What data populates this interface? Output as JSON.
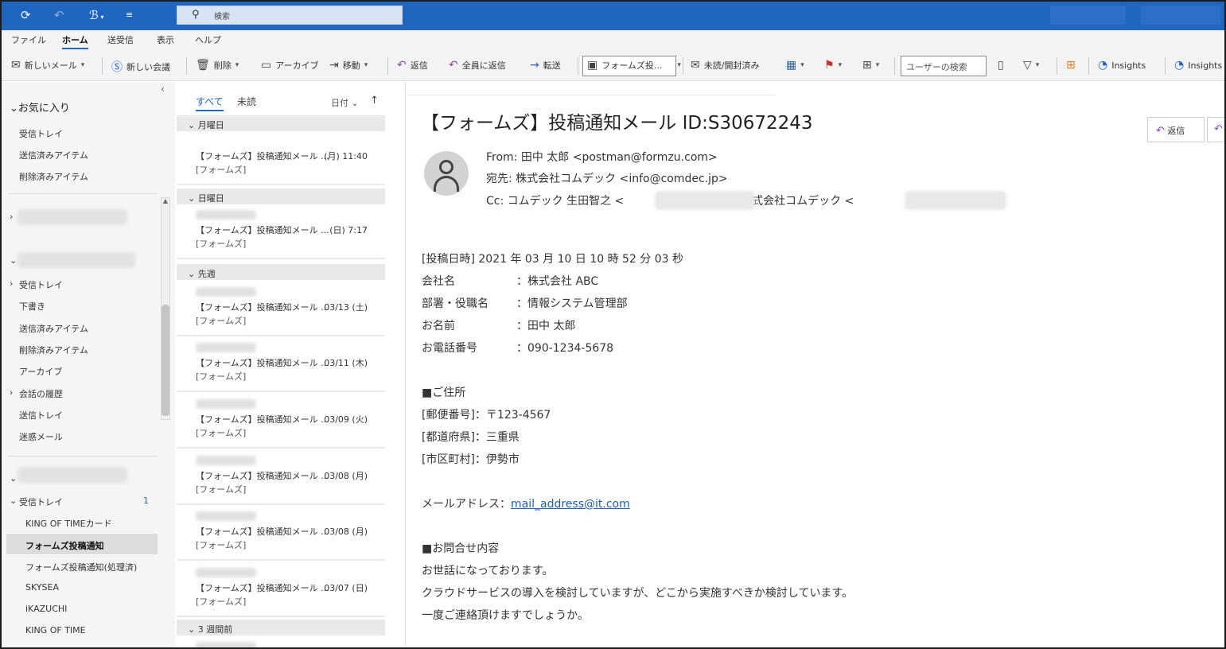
{
  "titlebar": {
    "search_icon": "search-icon",
    "search_placeholder": "検索"
  },
  "menu": [
    "ファイル",
    "ホーム",
    "送受信",
    "表示",
    "ヘルプ"
  ],
  "ribbon": {
    "new_mail": "新しいメール",
    "new_meeting": "新しい会議",
    "delete": "削除",
    "archive": "アーカイブ",
    "move": "移動",
    "reply": "返信",
    "reply_all": "全員に返信",
    "forward": "転送",
    "quick_step": "フォームズ投...",
    "unread_read": "未読/開封済み",
    "user_search": "ユーザーの検索",
    "insights1": "Insights",
    "insights2": "Insights"
  },
  "folders": {
    "favorites_title": "お気に入り",
    "favorites": [
      "受信トレイ",
      "送信済みアイテム",
      "削除済みアイテム"
    ],
    "account2_items": [
      "受信トレイ",
      "下書き",
      "送信済みアイテム",
      "削除済みアイテム",
      "アーカイブ",
      "会話の履歴",
      "送信トレイ",
      "迷惑メール"
    ],
    "inbox_label": "受信トレイ",
    "inbox_count": "1",
    "inbox_subfolders": [
      "KING OF TIMEカード",
      "フォームズ投稿通知",
      "フォームズ投稿通知(処理済)",
      "SKYSEA",
      "iKAZUCHI",
      "KING OF TIME"
    ]
  },
  "list": {
    "tab_all": "すべて",
    "tab_unread": "未読",
    "sort": "日付",
    "groups": [
      "月曜日",
      "日曜日",
      "先週",
      "3 週間前"
    ],
    "items": [
      {
        "subject": "【フォームズ】投稿通知メール ...",
        "date": "(月) 11:40",
        "folder": "[フォームズ]"
      },
      {
        "subject": "【フォームズ】投稿通知メール ...",
        "date": "(日) 7:17",
        "folder": "[フォームズ]"
      },
      {
        "subject": "【フォームズ】投稿通知メール ...",
        "date": "03/13 (土)",
        "folder": "[フォームズ]"
      },
      {
        "subject": "【フォームズ】投稿通知メール ...",
        "date": "03/11 (木)",
        "folder": "[フォームズ]"
      },
      {
        "subject": "【フォームズ】投稿通知メール ...",
        "date": "03/09 (火)",
        "folder": "[フォームズ]"
      },
      {
        "subject": "【フォームズ】投稿通知メール ...",
        "date": "03/08 (月)",
        "folder": "[フォームズ]"
      },
      {
        "subject": "【フォームズ】投稿通知メール ...",
        "date": "03/08 (月)",
        "folder": "[フォームズ]"
      },
      {
        "subject": "【フォームズ】投稿通知メール ...",
        "date": "03/07 (日)",
        "folder": "[フォームズ]"
      }
    ]
  },
  "reading": {
    "subject": "【フォームズ】投稿通知メール ID:S30672243",
    "from": "From:  田中  太郎  <postman@formzu.com>",
    "to": "宛先:  株式会社コムデック  <info@comdec.jp>",
    "cc_prefix": "Cc:  コムデック    生田智之  <",
    "cc_mid": ">;  株式会社コムデック  <",
    "cc_suffix": ">",
    "reply_button": "返信",
    "body": {
      "posted": "[投稿日時] 2021 年 03 月 10 日  10 時 52 分 03 秒",
      "fields": [
        {
          "label": "会社名",
          "value": "：株式会社 ABC"
        },
        {
          "label": "部署・役職名",
          "value": "：情報システム管理部"
        },
        {
          "label": "お名前",
          "value": "：田中 太郎"
        },
        {
          "label": "お電話番号",
          "value": "：090-1234-5678"
        }
      ],
      "address_heading": "■ご住所",
      "postal": "[郵便番号]：〒123-4567",
      "prefecture": "[都道府県]：三重県",
      "city": "[市区町村]：伊勢市",
      "email_label": "メールアドレス：",
      "email": "mail_address@it.com",
      "inquiry_heading": "■お問合せ内容",
      "inquiry_lines": [
        "お世話になっております。",
        "クラウドサービスの導入を検討していますが、どこから実施すべきか検討しています。",
        "一度ご連絡頂けますでしょうか。"
      ]
    }
  },
  "colors": {
    "titlebar": "#1f66c1",
    "accent": "#1f66c1",
    "link": "#1f5fb5"
  }
}
